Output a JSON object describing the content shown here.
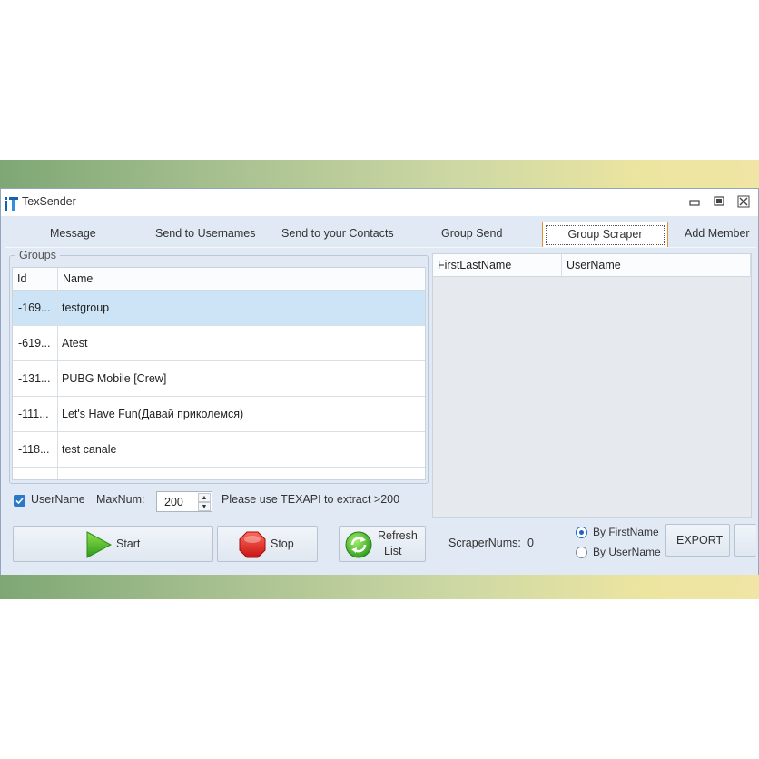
{
  "window": {
    "title": "TexSender",
    "controls": {
      "minimize": "▭",
      "restore": "◘",
      "close": "✕"
    }
  },
  "tabs": [
    {
      "label": "Message"
    },
    {
      "label": "Send to Usernames"
    },
    {
      "label": "Send to your Contacts"
    },
    {
      "label": "Group Send"
    },
    {
      "label": "Group Scraper",
      "active": true
    },
    {
      "label": "Add Member"
    }
  ],
  "groups": {
    "legend": "Groups",
    "columns": [
      "Id",
      "Name"
    ],
    "rows": [
      {
        "id": "-169...",
        "name": "testgroup",
        "selected": true
      },
      {
        "id": "-619...",
        "name": "Atest"
      },
      {
        "id": "-131...",
        "name": "PUBG Mobile [Crew]"
      },
      {
        "id": "-111...",
        "name": "Let's Have Fun(Давай приколемся)"
      },
      {
        "id": "-118...",
        "name": "test canale"
      }
    ]
  },
  "scraper_table": {
    "columns": [
      "FirstLastName",
      "UserName"
    ]
  },
  "options": {
    "username_label": "UserName",
    "username_checked": true,
    "maxnum_label": "MaxNum:",
    "maxnum_value": "200",
    "note": "Please use TEXAPI to extract >200"
  },
  "buttons": {
    "start": "Start",
    "stop": "Stop",
    "refresh_line1": "Refresh",
    "refresh_line2": "List",
    "export": "EXPORT"
  },
  "scraper": {
    "nums_label": "ScraperNums:",
    "nums_value": "0",
    "radio_firstname": "By FirstName",
    "radio_username": "By UserName",
    "selected": "By FirstName"
  },
  "colors": {
    "accent": "#2c79c9",
    "selection": "#cde4f7",
    "active_tab_border": "#e3922e"
  },
  "icons": {
    "app": "app-logo-icon",
    "start": "play-icon",
    "stop": "stop-octagon-icon",
    "refresh": "refresh-icon"
  }
}
